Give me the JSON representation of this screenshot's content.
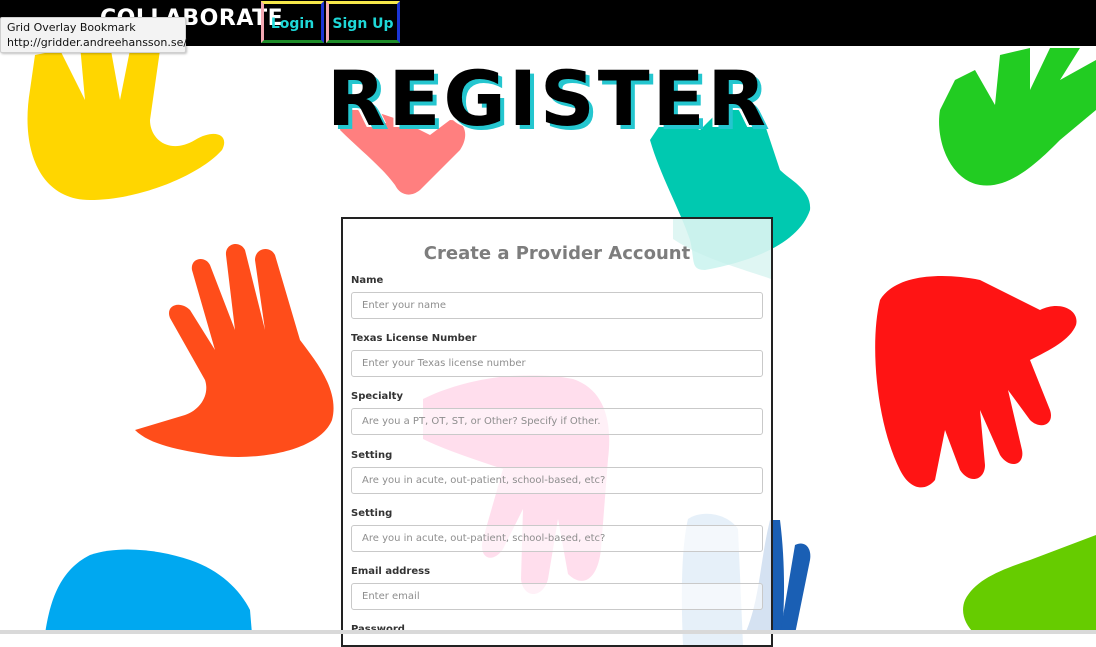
{
  "navbar": {
    "brand": "COLLABORATE",
    "login_label": "Login",
    "signup_label": "Sign Up"
  },
  "tooltip": {
    "title": "Grid Overlay Bookmark",
    "url": "http://gridder.andreehansson.se/"
  },
  "hero": {
    "title": "REGISTER"
  },
  "form": {
    "title": "Create a Provider Account",
    "fields": [
      {
        "label": "Name",
        "placeholder": "Enter your name"
      },
      {
        "label": "Texas License Number",
        "placeholder": "Enter your Texas license number"
      },
      {
        "label": "Specialty",
        "placeholder": "Are you a PT, OT, ST, or Other? Specify if Other."
      },
      {
        "label": "Setting",
        "placeholder": "Are you in acute, out-patient, school-based, etc?"
      },
      {
        "label": "Setting",
        "placeholder": "Are you in acute, out-patient, school-based, etc?"
      },
      {
        "label": "Email address",
        "placeholder": "Enter email"
      },
      {
        "label": "Password",
        "placeholder": ""
      }
    ]
  },
  "colors": {
    "navbar_bg": "#000000",
    "nav_text": "#1ed8d8",
    "hero_shadow": "#24c6cf",
    "hand_yellow": "#ffd600",
    "hand_pink": "#ff7f7f",
    "hand_teal": "#00c9b0",
    "hand_green": "#22cc22",
    "hand_orange": "#ff4d1a",
    "hand_red": "#ff1414",
    "hand_blue": "#00a8f0",
    "hand_lime": "#66cc00",
    "hand_navy": "#1a5fb4"
  }
}
